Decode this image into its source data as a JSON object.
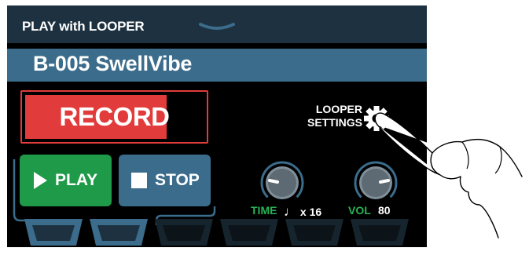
{
  "header": {
    "mode_title": "PLAY with LOOPER"
  },
  "patch": {
    "name": "B-005 SwellVibe"
  },
  "record": {
    "label": "RECORD",
    "level": 0.78
  },
  "looper_settings": {
    "line1": "LOOPER",
    "line2": "SETTINGS",
    "icon": "gear-icon"
  },
  "transport": {
    "play_label": "PLAY",
    "stop_label": "STOP"
  },
  "params": {
    "time": {
      "label": "TIME",
      "note_symbol": "♩",
      "value": "x 16"
    },
    "vol": {
      "label": "VOL",
      "value": "80"
    }
  },
  "colors": {
    "record": "#e23b3b",
    "play": "#1e9a48",
    "stop": "#3b6c8b",
    "topbar": "#1d3140",
    "patchbar": "#3b6c8b",
    "param_label": "#27b356"
  }
}
